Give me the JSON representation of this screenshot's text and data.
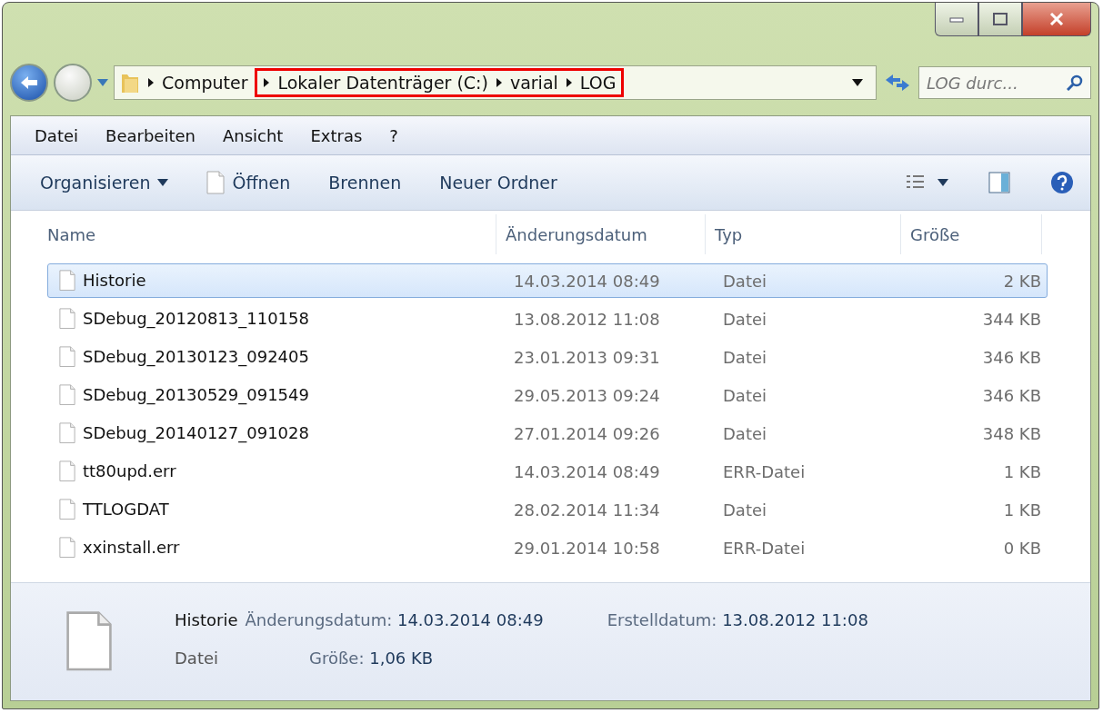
{
  "address": {
    "crumbs": [
      {
        "label": "Computer",
        "highlighted": false
      },
      {
        "label": "Lokaler Datenträger (C:)",
        "highlighted": true
      },
      {
        "label": "varial",
        "highlighted": true
      },
      {
        "label": "LOG",
        "highlighted": true
      }
    ],
    "search_placeholder": "LOG durc..."
  },
  "menu": [
    "Datei",
    "Bearbeiten",
    "Ansicht",
    "Extras",
    "?"
  ],
  "toolbar": [
    {
      "label": "Organisieren",
      "kind": "dropdown"
    },
    {
      "label": "Öffnen",
      "kind": "file"
    },
    {
      "label": "Brennen",
      "kind": "plain"
    },
    {
      "label": "Neuer Ordner",
      "kind": "plain"
    }
  ],
  "table": {
    "columns": [
      "Name",
      "Änderungsdatum",
      "Typ",
      "Größe"
    ],
    "rows": [
      {
        "name": "Historie",
        "date": "14.03.2014 08:49",
        "type": "Datei",
        "size": "2 KB",
        "selected": true
      },
      {
        "name": "SDebug_20120813_110158",
        "date": "13.08.2012 11:08",
        "type": "Datei",
        "size": "344 KB",
        "selected": false
      },
      {
        "name": "SDebug_20130123_092405",
        "date": "23.01.2013 09:31",
        "type": "Datei",
        "size": "346 KB",
        "selected": false
      },
      {
        "name": "SDebug_20130529_091549",
        "date": "29.05.2013 09:24",
        "type": "Datei",
        "size": "346 KB",
        "selected": false
      },
      {
        "name": "SDebug_20140127_091028",
        "date": "27.01.2014 09:26",
        "type": "Datei",
        "size": "348 KB",
        "selected": false
      },
      {
        "name": "tt80upd.err",
        "date": "14.03.2014 08:49",
        "type": "ERR-Datei",
        "size": "1 KB",
        "selected": false
      },
      {
        "name": "TTLOGDAT",
        "date": "28.02.2014 11:34",
        "type": "Datei",
        "size": "1 KB",
        "selected": false
      },
      {
        "name": "xxinstall.err",
        "date": "29.01.2014 10:58",
        "type": "ERR-Datei",
        "size": "0 KB",
        "selected": false
      }
    ]
  },
  "details": {
    "name": "Historie",
    "type": "Datei",
    "fields": [
      {
        "label": "Änderungsdatum:",
        "value": "14.03.2014 08:49"
      },
      {
        "label": "Erstelldatum:",
        "value": "13.08.2012 11:08"
      },
      {
        "label": "Größe:",
        "value": "1,06 KB"
      }
    ]
  }
}
